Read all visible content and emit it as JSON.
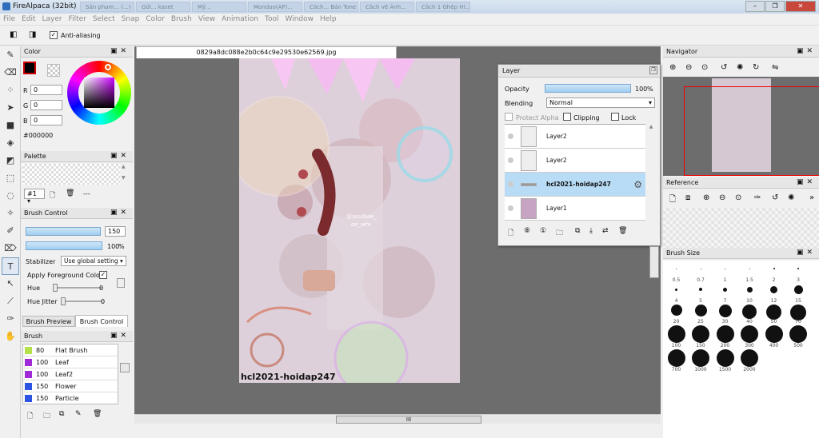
{
  "window": {
    "title": "FireAlpaca (32bit)",
    "bg_tabs": [
      "Sản pham... (...)",
      "Gửi... kaset",
      "Mỹ...",
      "Mondao(AP)...",
      "Cách... Bán Tone",
      "Cách vẽ Ánh...",
      "Cách 1 Ghép Hi..."
    ]
  },
  "menu": [
    "File",
    "Edit",
    "Layer",
    "Filter",
    "Select",
    "Snap",
    "Color",
    "Brush",
    "View",
    "Animation",
    "Tool",
    "Window",
    "Help"
  ],
  "tool_options": {
    "anti_aliasing": "Anti-aliasing",
    "anti_aliasing_checked": true
  },
  "color_panel": {
    "title": "Color",
    "r_label": "R",
    "g_label": "G",
    "b_label": "B",
    "r": "0",
    "g": "0",
    "b": "0",
    "hex": "#000000"
  },
  "palette_panel": {
    "title": "Palette",
    "selector": "#1",
    "dash": "---"
  },
  "brush_control": {
    "title": "Brush Control",
    "size": "150",
    "opacity_value": "100",
    "opacity_unit": "%",
    "stabilizer_label": "Stabilizer",
    "stabilizer_value": "Use global setting",
    "apply_fg_label": "Apply Foreground Color",
    "hue_label": "Hue",
    "hue_value": "0",
    "hue_jitter_label": "Hue Jitter",
    "hue_jitter_value": "0",
    "tab_preview": "Brush Preview",
    "tab_control": "Brush Control"
  },
  "brush_list": {
    "title": "Brush",
    "items": [
      {
        "size": "80",
        "name": "Flat Brush",
        "color": "#b4e04a"
      },
      {
        "size": "100",
        "name": "Leaf",
        "color": "#a02ad8"
      },
      {
        "size": "100",
        "name": "Leaf2",
        "color": "#a02ad8"
      },
      {
        "size": "150",
        "name": "Flower",
        "color": "#2b55e0"
      },
      {
        "size": "150",
        "name": "Particle",
        "color": "#2b55e0"
      }
    ]
  },
  "document": {
    "tab": "0829a8dc088e2b0c64c9e29530e62569.jpg",
    "watermark": "hcl2021-hoidap247",
    "overlay_text": "@soulbae_\non_whi"
  },
  "layer_window": {
    "title": "Layer",
    "opacity_label": "Opacity",
    "opacity_value": "100",
    "opacity_unit": "%",
    "blending_label": "Blending",
    "blending_value": "Normal",
    "protect_alpha": "Protect Alpha",
    "clipping": "Clipping",
    "lock": "Lock",
    "layers": [
      {
        "name": "Layer2",
        "selected": false
      },
      {
        "name": "Layer2",
        "selected": false
      },
      {
        "name": "hcl2021-hoidap247",
        "selected": true
      },
      {
        "name": "Layer1",
        "selected": false
      }
    ]
  },
  "navigator": {
    "title": "Navigator"
  },
  "reference": {
    "title": "Reference"
  },
  "brush_size": {
    "title": "Brush Size",
    "sizes": [
      "0.5",
      "0.7",
      "1",
      "1.5",
      "2",
      "3",
      "4",
      "5",
      "7",
      "10",
      "12",
      "15",
      "20",
      "25",
      "30",
      "40",
      "50",
      "70",
      "100",
      "150",
      "200",
      "300",
      "400",
      "500",
      "700",
      "1000",
      "1500",
      "2000"
    ]
  },
  "scrollbar": {
    "grip": "III"
  }
}
